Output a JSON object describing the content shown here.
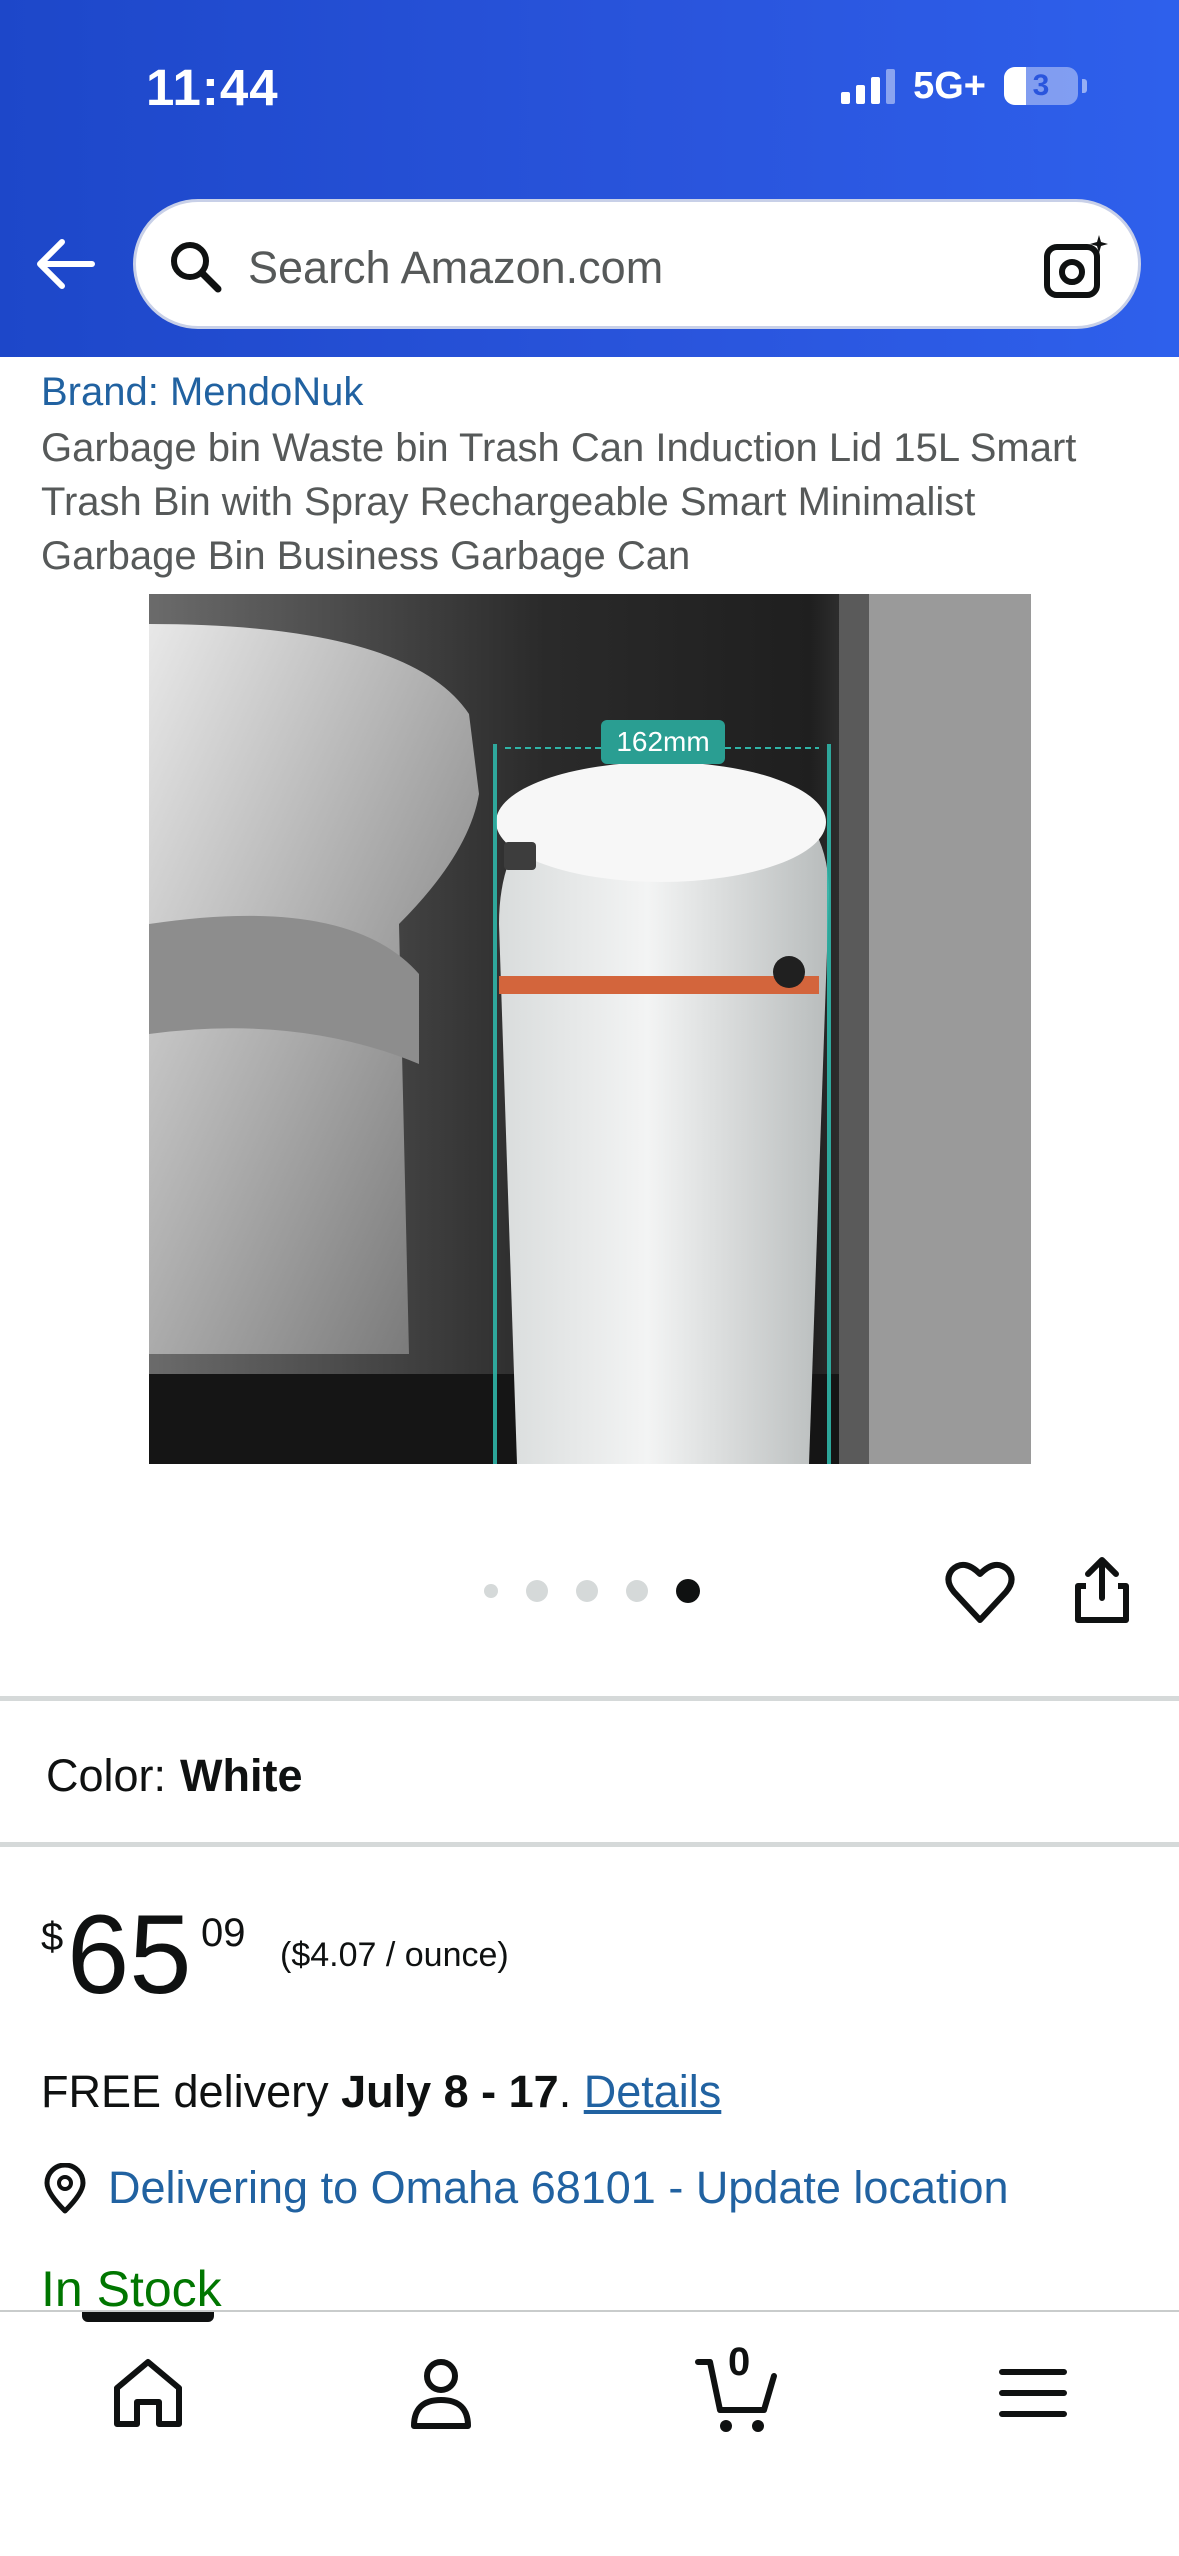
{
  "status_bar": {
    "time": "11:44",
    "network": "5G+",
    "battery": "3",
    "battery_level_percent": 30
  },
  "search": {
    "placeholder": "Search Amazon.com"
  },
  "product": {
    "brand": "Brand: MendoNuk",
    "title": "Garbage bin Waste bin Trash Can Induction Lid 15L Smart Trash Bin with Spray Rechargeable Smart Minimalist Garbage Bin Business Garbage Can",
    "image_dimension_label": "162mm",
    "image_count": 5,
    "active_image_index": 5
  },
  "color": {
    "label": "Color:",
    "value": "White"
  },
  "price": {
    "symbol": "$",
    "whole": "65",
    "fraction": "09",
    "unit_price": "($4.07 / ounce)"
  },
  "delivery": {
    "prefix": "FREE delivery ",
    "dates": "July 8 - 17",
    "separator": ". ",
    "details_link": "Details"
  },
  "location": {
    "text": "Delivering to Omaha 68101 - Update location"
  },
  "stock": {
    "text": "In Stock"
  },
  "bottom_nav": {
    "items": [
      "home-icon",
      "account-icon",
      "cart-icon",
      "menu-icon"
    ],
    "cart_count": "0"
  },
  "colors": {
    "header_blue": "#2a55dd",
    "link_blue": "#2162a1",
    "in_stock_green": "#007600",
    "teal_accent": "#2fb5a8"
  }
}
